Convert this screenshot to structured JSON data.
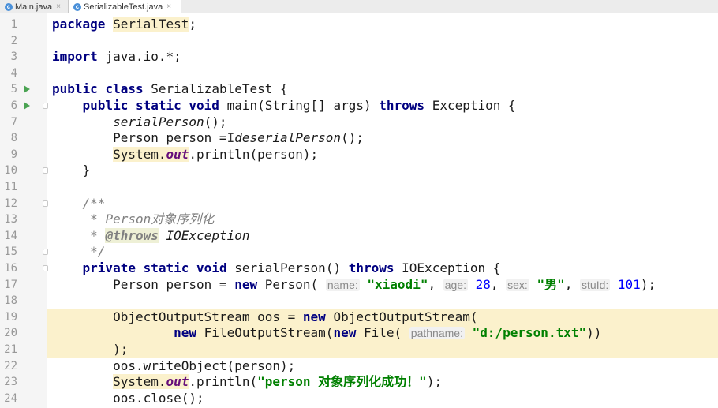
{
  "tabs": [
    {
      "label": "Main.java",
      "icon": "java-class-icon",
      "close": "×"
    },
    {
      "label": "SerializableTest.java",
      "icon": "java-class-icon",
      "close": "×"
    }
  ],
  "lines": [
    {
      "n": "1"
    },
    {
      "n": "2"
    },
    {
      "n": "3"
    },
    {
      "n": "4"
    },
    {
      "n": "5"
    },
    {
      "n": "6"
    },
    {
      "n": "7"
    },
    {
      "n": "8"
    },
    {
      "n": "9"
    },
    {
      "n": "10"
    },
    {
      "n": "11"
    },
    {
      "n": "12"
    },
    {
      "n": "13"
    },
    {
      "n": "14"
    },
    {
      "n": "15"
    },
    {
      "n": "16"
    },
    {
      "n": "17"
    },
    {
      "n": "18"
    },
    {
      "n": "19"
    },
    {
      "n": "20"
    },
    {
      "n": "21"
    },
    {
      "n": "22"
    },
    {
      "n": "23"
    },
    {
      "n": "24"
    }
  ],
  "code": {
    "package_kw": "package",
    "package_name": "SerialTest",
    "import_kw": "import",
    "import_path": "java.io.*",
    "public_kw": "public",
    "class_kw": "class",
    "class_name": "SerializableTest",
    "static_kw": "static",
    "void_kw": "void",
    "main_sig": "main(String[] args)",
    "throws_kw": "throws",
    "exception": "Exception",
    "serial_person_call": "serialPerson",
    "person_decl": "Person person =",
    "deserial_call": "deserialPerson",
    "system": "System.",
    "out": "out",
    "println_person": ".println(person);",
    "javadoc_open": "/**",
    "javadoc_star": "*",
    "javadoc_desc": "Person对象序列化",
    "javadoc_tag": "@throws",
    "javadoc_ex": "IOException",
    "javadoc_close": "*/",
    "private_kw": "private",
    "serial_person_sig": "serialPerson()",
    "io_exception": "IOException",
    "new_kw": "new",
    "person_ctor": "Person(",
    "hint_name": "name:",
    "val_name": "\"xiaodi\"",
    "hint_age": "age:",
    "val_age": "28",
    "hint_sex": "sex:",
    "val_sex": "\"男\"",
    "hint_stuid": "stuId:",
    "val_stuid": "101",
    "oos_decl": "ObjectOutputStream oos =",
    "oos_ctor": "ObjectOutputStream(",
    "fos_ctor": "FileOutputStream(",
    "file_ctor": "File(",
    "hint_pathname": "pathname:",
    "val_path": "\"d:/person.txt\"",
    "close_paren_semi": ");",
    "write_object": "oos.writeObject(person);",
    "println_success_open": ".println(",
    "val_success": "\"person 对象序列化成功！\"",
    "oos_close": "oos.close();"
  },
  "colors": {
    "keyword": "#000080",
    "string": "#008000",
    "number": "#0000ff",
    "static_field": "#660e7a",
    "comment": "#808080",
    "highlight": "#fbf1cc",
    "run_icon": "#4aa352"
  }
}
